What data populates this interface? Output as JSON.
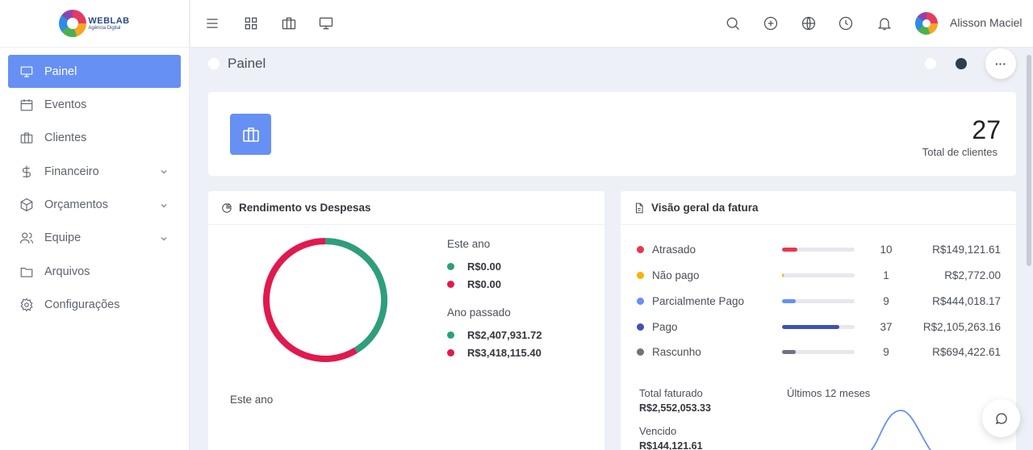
{
  "brand": {
    "logo_title": "WEBLAB",
    "logo_subtitle": "Agência Digital"
  },
  "sidebar": {
    "items": [
      {
        "label": "Painel",
        "icon": "monitor-icon",
        "active": true
      },
      {
        "label": "Eventos",
        "icon": "calendar-icon"
      },
      {
        "label": "Clientes",
        "icon": "briefcase-icon"
      },
      {
        "label": "Financeiro",
        "icon": "dollar-icon",
        "expandable": true
      },
      {
        "label": "Orçamentos",
        "icon": "box-icon",
        "expandable": true
      },
      {
        "label": "Equipe",
        "icon": "users-icon",
        "expandable": true
      },
      {
        "label": "Arquivos",
        "icon": "folder-icon"
      },
      {
        "label": "Configurações",
        "icon": "settings-icon"
      }
    ]
  },
  "topbar": {
    "icons": [
      "menu-icon",
      "grid-icon",
      "briefcase-icon",
      "monitor-icon",
      "search-icon",
      "plus-circle-icon",
      "globe-icon",
      "clock-icon",
      "bell-icon"
    ],
    "user_name": "Alisson Maciel"
  },
  "page": {
    "title": "Painel",
    "more_label": "···"
  },
  "clients_card": {
    "count": "27",
    "label": "Total de clientes"
  },
  "income_card": {
    "title": "Rendimento vs Despesas",
    "this_year_label": "Este ano",
    "this_year_income": "R$0.00",
    "this_year_expense": "R$0.00",
    "last_year_label": "Ano passado",
    "last_year_income": "R$2,407,931.72",
    "last_year_expense": "R$3,418,115.40",
    "footer_label": "Este ano",
    "colors": {
      "income": "#2e9e7c",
      "expense": "#e0194e"
    }
  },
  "invoice_card": {
    "title": "Visão geral da fatura",
    "rows": [
      {
        "label": "Atrasado",
        "count": "10",
        "amount": "R$149,121.61",
        "color": "#e8374f",
        "fill": 0.21
      },
      {
        "label": "Não pago",
        "count": "1",
        "amount": "R$2,772.00",
        "color": "#f5b400",
        "fill": 0.02
      },
      {
        "label": "Parcialmente Pago",
        "count": "9",
        "amount": "R$444,018.17",
        "color": "#6690f4",
        "fill": 0.19
      },
      {
        "label": "Pago",
        "count": "37",
        "amount": "R$2,105,263.16",
        "color": "#3f51b5",
        "fill": 0.79
      },
      {
        "label": "Rascunho",
        "count": "9",
        "amount": "R$694,422.61",
        "color": "#6c757d",
        "fill": 0.19
      }
    ],
    "total_invoiced_label": "Total faturado",
    "total_invoiced_value": "R$2,552,053.33",
    "due_label": "Vencido",
    "due_value": "R$144,121.61",
    "months_label": "Últimos 12 meses"
  },
  "chart_data": {
    "type": "pie",
    "title": "Rendimento vs Despesas",
    "categories": [
      "income",
      "expense"
    ],
    "values": [
      2407931.72,
      3418115.4
    ]
  }
}
